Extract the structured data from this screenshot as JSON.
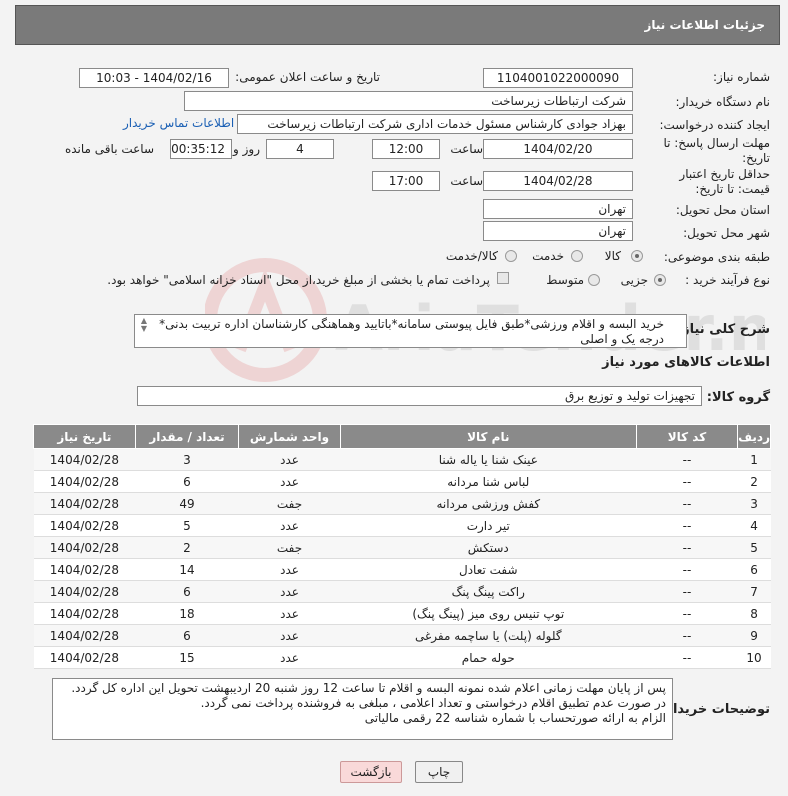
{
  "header": {
    "title": "جزئیات اطلاعات نیاز"
  },
  "watermark": {
    "text": "AriaTender.net"
  },
  "form": {
    "need_number_label": "شماره نیاز:",
    "need_number": "1104001022000090",
    "announce_label": "تاریخ و ساعت اعلان عمومی:",
    "announce_value": "1404/02/16 - 10:03",
    "buyer_org_label": "نام دستگاه خریدار:",
    "buyer_org": "شرکت ارتباطات زیرساخت",
    "creator_label": "ایجاد کننده درخواست:",
    "creator": "بهزاد جوادی کارشناس مسئول خدمات اداری شرکت ارتباطات زیرساخت",
    "contact_link": "اطلاعات تماس خریدار",
    "reply_deadline_label": "مهلت ارسال پاسخ: تا تاریخ:",
    "reply_date": "1404/02/20",
    "time_label": "ساعت",
    "reply_time": "12:00",
    "days_value": "4",
    "days_label": "روز و",
    "remaining_value": "00:35:12",
    "remaining_label": "ساعت باقی مانده",
    "price_validity_label": "حداقل تاریخ اعتبار قیمت: تا تاریخ:",
    "price_date": "1404/02/28",
    "price_time": "17:00",
    "province_label": "استان محل تحویل:",
    "province": "تهران",
    "city_label": "شهر محل تحویل:",
    "city": "تهران",
    "category_label": "طبقه بندی موضوعی:",
    "category_options": [
      "کالا",
      "خدمت",
      "کالا/خدمت"
    ],
    "process_label": "نوع فرآیند خرید :",
    "process_options": [
      "جزیی",
      "متوسط"
    ],
    "payment_note": "پرداخت تمام یا بخشی از مبلغ خرید،از محل \"اسناد خزانه اسلامی\" خواهد بود.",
    "description_label": "شرح کلی نیاز:",
    "description": "خرید البسه و اقلام ورزشی*طبق فایل پیوستی سامانه*باتایید وهماهنگی کارشناسان اداره تربیت بدنی* درجه یک و اصلی"
  },
  "goods": {
    "section_title": "اطلاعات کالاهای مورد نیاز",
    "group_label": "گروه کالا:",
    "group_value": "تجهیزات تولید و توزیع برق",
    "columns": [
      "ردیف",
      "کد کالا",
      "نام کالا",
      "واحد شمارش",
      "تعداد / مقدار",
      "تاریخ نیاز"
    ],
    "rows": [
      [
        "1",
        "--",
        "عینک شنا یا یاله شنا",
        "عدد",
        "3",
        "1404/02/28"
      ],
      [
        "2",
        "--",
        "لباس شنا مردانه",
        "عدد",
        "6",
        "1404/02/28"
      ],
      [
        "3",
        "--",
        "کفش ورزشی مردانه",
        "جفت",
        "49",
        "1404/02/28"
      ],
      [
        "4",
        "--",
        "تیر دارت",
        "عدد",
        "5",
        "1404/02/28"
      ],
      [
        "5",
        "--",
        "دستکش",
        "جفت",
        "2",
        "1404/02/28"
      ],
      [
        "6",
        "--",
        "شفت تعادل",
        "عدد",
        "14",
        "1404/02/28"
      ],
      [
        "7",
        "--",
        "راکت پینگ پنگ",
        "عدد",
        "6",
        "1404/02/28"
      ],
      [
        "8",
        "--",
        "توپ تنیس روی میز (پینگ پنگ)",
        "عدد",
        "18",
        "1404/02/28"
      ],
      [
        "9",
        "--",
        "گلوله (پلت) یا ساچمه مفرغی",
        "عدد",
        "6",
        "1404/02/28"
      ],
      [
        "10",
        "--",
        "حوله حمام",
        "عدد",
        "15",
        "1404/02/28"
      ]
    ]
  },
  "buyer_notes": {
    "label": "توضیحات خریدار:",
    "lines": [
      "پس از پایان مهلت زمانی اعلام شده نمونه البسه و اقلام تا ساعت 12 روز شنبه 20 اردیبهشت تحویل این اداره کل گردد.",
      "در صورت عدم تطبیق اقلام درخواستی و تعداد اعلامی ، مبلغی به فروشنده پرداخت نمی گردد.",
      "الزام به ارائه صورتحساب با شماره شناسه 22 رقمی مالیاتی"
    ]
  },
  "buttons": {
    "print": "چاپ",
    "back": "بازگشت"
  }
}
